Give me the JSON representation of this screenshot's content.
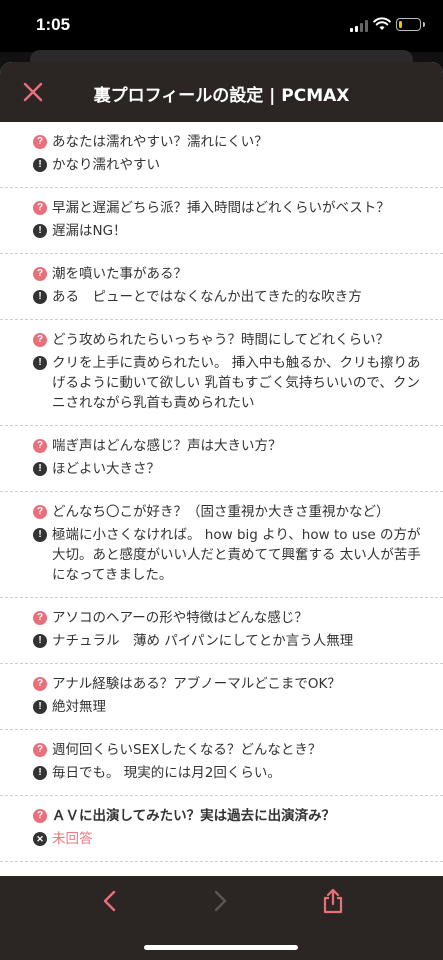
{
  "status_bar": {
    "time": "1:05",
    "battery_level": 0.15,
    "battery_color": "#f5c400"
  },
  "header": {
    "title": "裏プロフィールの設定 | PCMAX",
    "close_icon": "close-icon",
    "accent": "#e8707a"
  },
  "qa_items": [
    {
      "question": "あなたは濡れやすい？濡れにくい？",
      "answer": "かなり濡れやすい"
    },
    {
      "question": "早漏と遅漏どちら派？挿入時間はどれくらいがベスト？",
      "answer": "遅漏はNG！"
    },
    {
      "question": "潮を噴いた事がある？",
      "answer": "ある　ピューとではなくなんか出てきた的な吹き方"
    },
    {
      "question": "どう攻められたらいっちゃう？時間にしてどれくらい？",
      "answer": "クリを上手に責められたい。 挿入中も触るか、クリも擦りあげるように動いて欲しい 乳首もすごく気持ちいいので、クンニされながら乳首も責められたい"
    },
    {
      "question": "喘ぎ声はどんな感じ？声は大きい方？",
      "answer": "ほどよい大きさ？"
    },
    {
      "question": "どんなち〇こが好き？（固さ重視か大きさ重視かなど）",
      "answer": "極端に小さくなければ。 how big より、how to use の方が大切。あと感度がいい人だと責めてて興奮する 太い人が苦手になってきました。"
    },
    {
      "question": "アソコのヘアーの形や特徴はどんな感じ？",
      "answer": "ナチュラル　薄め パイパンにしてとか言う人無理"
    },
    {
      "question": "アナル経験はある？アブノーマルどこまでOK？",
      "answer": "絶対無理"
    },
    {
      "question": "週何回くらいSEXしたくなる？どんなとき？",
      "answer": "毎日でも。 現実的には月2回くらい。"
    }
  ],
  "last_item": {
    "question": "ＡＶに出演してみたい？実は過去に出演済み？",
    "answer": "未回答",
    "answer_color": "#e87a80"
  },
  "icons": {
    "question": "question-icon",
    "answer": "exclamation-icon",
    "unanswered": "x-icon"
  },
  "bottom_bar": {
    "back_icon": "chevron-left-icon",
    "forward_icon": "chevron-right-icon",
    "share_icon": "share-icon"
  }
}
